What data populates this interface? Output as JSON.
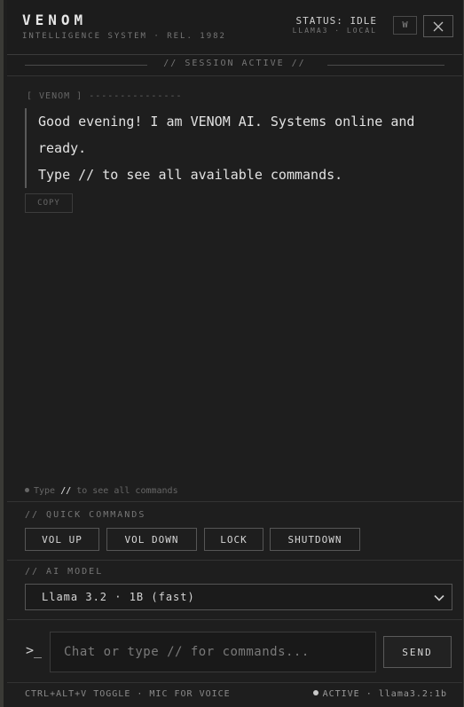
{
  "header": {
    "title": "VENOM",
    "subtitle": "INTELLIGENCE SYSTEM · REL. 1982",
    "status": "STATUS: IDLE",
    "status_sub": "LLAMA3 · LOCAL",
    "w_label": "W"
  },
  "session_banner": "// SESSION ACTIVE //",
  "message": {
    "sender": "[ VENOM ] ---------------",
    "line1": "Good evening! I am VENOM AI. Systems online and ready.",
    "line2": "Type // to see all available commands.",
    "copy_label": "COPY"
  },
  "hint": {
    "before": "Type",
    "key": "//",
    "after": "to see all commands"
  },
  "quick_commands": {
    "label": "// QUICK COMMANDS",
    "buttons": [
      "VOL UP",
      "VOL DOWN",
      "LOCK",
      "SHUTDOWN"
    ]
  },
  "model": {
    "label": "// AI MODEL",
    "selected": "Llama 3.2 · 1B (fast)"
  },
  "input": {
    "prompt_symbol": ">_",
    "placeholder": "Chat or type // for commands...",
    "send_label": "SEND"
  },
  "footer": {
    "left": "CTRL+ALT+V TOGGLE · MIC FOR VOICE",
    "status": "ACTIVE",
    "model_tag": "· llama3.2:1b"
  },
  "colors": {
    "background": "#1e1e1e",
    "text": "#e2e2e2",
    "muted": "#777777",
    "border": "#565656"
  }
}
